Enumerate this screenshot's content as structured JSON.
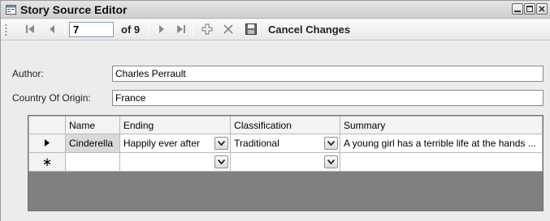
{
  "window": {
    "title": "Story Source Editor"
  },
  "navigator": {
    "position": "7",
    "count_label": "of 9",
    "cancel_label": "Cancel Changes"
  },
  "fields": {
    "author_label": "Author:",
    "author_value": "Charles Perrault",
    "country_label": "Country Of Origin:",
    "country_value": "France"
  },
  "grid": {
    "columns": [
      "Name",
      "Ending",
      "Classification",
      "Summary"
    ],
    "rows": [
      {
        "name": "Cinderella",
        "ending": "Happily ever after",
        "classification": "Traditional",
        "summary": "A young girl has a terrible life at the hands ..."
      }
    ],
    "new_row_marker": "∗"
  }
}
